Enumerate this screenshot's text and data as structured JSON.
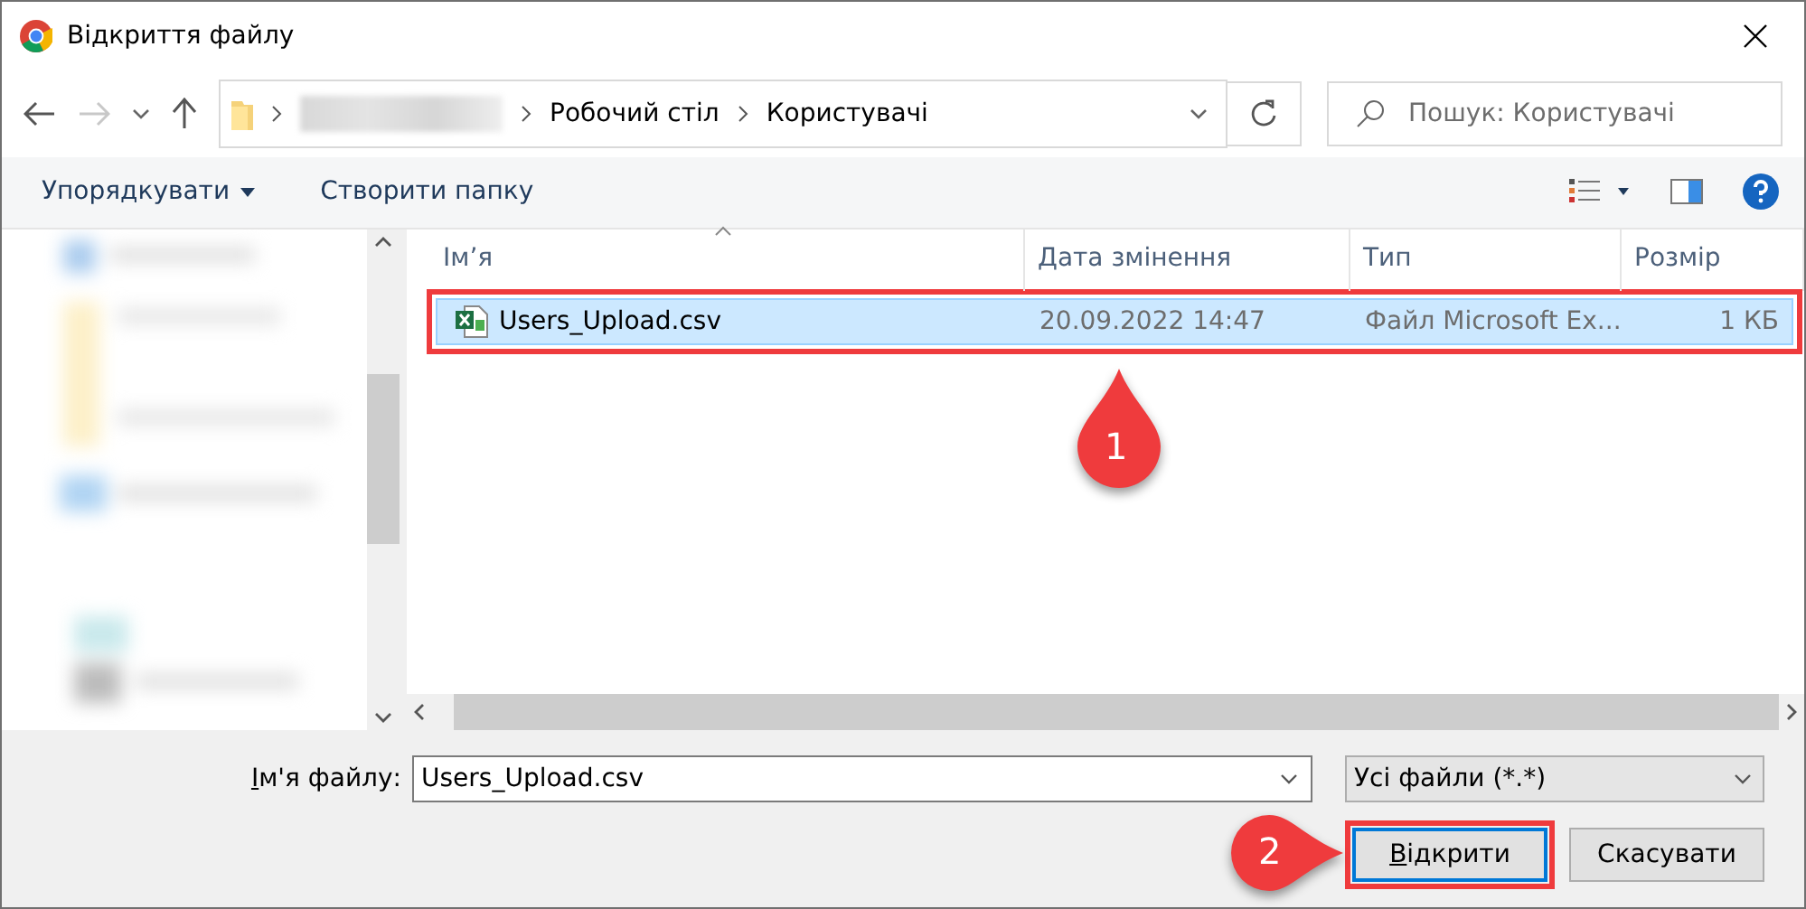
{
  "window": {
    "title": "Відкриття файлу"
  },
  "address": {
    "crumbs": [
      "Робочий стіл",
      "Користувачі"
    ]
  },
  "search": {
    "placeholder": "Пошук: Користувачі"
  },
  "toolbar": {
    "organize": "Упорядкувати",
    "new_folder": "Створити папку"
  },
  "table": {
    "columns": [
      "Ім’я",
      "Дата змінення",
      "Тип",
      "Розмір"
    ],
    "rows": [
      {
        "name": "Users_Upload.csv",
        "date": "20.09.2022 14:47",
        "type": "Файл Microsoft Ex...",
        "size": "1 КБ",
        "selected": true
      }
    ]
  },
  "file_name": {
    "label": "Ім'я файлу:",
    "value": "Users_Upload.csv"
  },
  "file_type": {
    "value": "Усі файли (*.*)"
  },
  "buttons": [
    {
      "label": "Відкрити",
      "kind": "primary"
    },
    {
      "label": "Скасувати",
      "kind": "normal"
    }
  ],
  "annotations": [
    {
      "label": "1",
      "kind": "drop"
    },
    {
      "label": "2",
      "kind": "pointer"
    }
  ]
}
